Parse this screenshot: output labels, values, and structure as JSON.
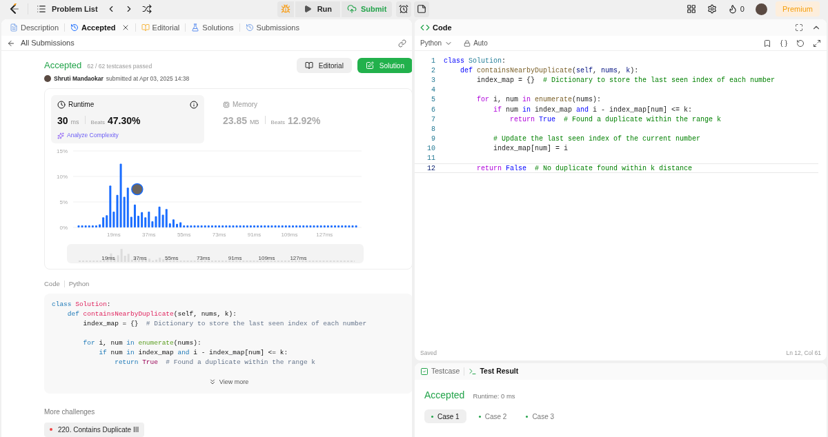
{
  "topbar": {
    "title": "Problem List",
    "run": "Run",
    "submit": "Submit",
    "streak": "0",
    "premium": "Premium"
  },
  "left_tabs": [
    {
      "label": "Description",
      "kind": "doc",
      "selected": false,
      "closable": false
    },
    {
      "label": "Accepted",
      "kind": "history",
      "selected": true,
      "closable": true
    },
    {
      "label": "Editorial",
      "kind": "book",
      "selected": false,
      "closable": false
    },
    {
      "label": "Solutions",
      "kind": "flask",
      "selected": false,
      "closable": false
    },
    {
      "label": "Submissions",
      "kind": "history",
      "selected": false,
      "closable": false
    }
  ],
  "back_link": "All Submissions",
  "submission": {
    "status": "Accepted",
    "testcases": "62 / 62 testcases passed",
    "author": "Shruti Mandaokar",
    "submitted": "submitted at Apr 03, 2025 14:38",
    "editorial_button": "Editorial",
    "solution_button": "Solution"
  },
  "stats": [
    {
      "label": "Runtime",
      "kind": "time",
      "value": "30",
      "unit": "ms",
      "beats_label": "Beats",
      "beats": "47.30%",
      "selected": true
    },
    {
      "label": "Memory",
      "kind": "memory",
      "value": "23.85",
      "unit": "MB",
      "beats_label": "Beats",
      "beats": "12.92%",
      "selected": false
    }
  ],
  "analyze": "Analyze Complexity",
  "chart": {
    "chart_data": {
      "type": "bar",
      "ylim": [
        0,
        15
      ],
      "xlim": [
        0,
        145
      ],
      "yticks": [
        {
          "value": 0,
          "label": "0%"
        },
        {
          "value": 5,
          "label": "5%"
        },
        {
          "value": 10,
          "label": "10%"
        },
        {
          "value": 15,
          "label": "15%"
        }
      ],
      "xticks": [
        {
          "value": 19,
          "label": "19ms"
        },
        {
          "value": 37,
          "label": "37ms"
        },
        {
          "value": 55,
          "label": "55ms"
        },
        {
          "value": 73,
          "label": "73ms"
        },
        {
          "value": 91,
          "label": "91ms"
        },
        {
          "value": 109,
          "label": "109ms"
        },
        {
          "value": 127,
          "label": "127ms"
        }
      ],
      "x": [
        1,
        2.8,
        4.6,
        6.4,
        8.2,
        10,
        11.8,
        13.6,
        15.4,
        17.2,
        19,
        20.8,
        22.6,
        24.4,
        26.2,
        28,
        29.8,
        31.6,
        33.4,
        35.2,
        37,
        38.8,
        40.6,
        42.4,
        44.2,
        46,
        47.8,
        49.6,
        51.4,
        53.2,
        55,
        56.8,
        58.6,
        60.4,
        62.2,
        64,
        65.8,
        67.6,
        69.4,
        71.2,
        73,
        74.8,
        76.6,
        78.4,
        80.2,
        82,
        83.8,
        85.6,
        87.4,
        89.2,
        91,
        92.8,
        94.6,
        96.4,
        98.2,
        100,
        101.8,
        103.6,
        105.4,
        107.2,
        109,
        110.8,
        112.6,
        114.4,
        116.2,
        118,
        119.8,
        121.6,
        123.4,
        125.2,
        127,
        128.8,
        130.6,
        132.4,
        134.2,
        136,
        137.8,
        139.6,
        141.4,
        143.2
      ],
      "series": [
        {
          "color": "#1a6dff",
          "values": [
            0.4,
            0.4,
            0.4,
            0.4,
            0.4,
            0.4,
            0.6,
            2.0,
            2.4,
            8.2,
            3.1,
            6.4,
            12.5,
            6.0,
            7.8,
            2.1,
            4.5,
            2.3,
            3.0,
            2.0,
            3.1,
            1.2,
            2.2,
            4.1,
            2.5,
            3.6,
            0.8,
            1.6,
            0.7,
            1.0,
            0.4,
            0.4,
            0.4,
            0.4,
            0.4,
            0.4,
            0.4,
            0.4,
            0.4,
            0.4,
            0.4,
            0.4,
            0.4,
            0.4,
            0.4,
            0.4,
            0.4,
            0.4,
            0.4,
            0.4,
            0.4,
            0.4,
            0.4,
            0.4,
            0.4,
            0.4,
            0.4,
            0.4,
            0.4,
            0.4,
            0.4,
            0.4,
            0.4,
            0.4,
            0.4,
            0.4,
            0.4,
            0.4,
            0.4,
            0.4,
            0.4,
            0.4,
            0.4,
            0.4,
            0.4,
            0.4,
            0.4,
            0.4,
            0.4,
            0.4
          ]
        }
      ]
    },
    "navigator_labels": [
      "19ms",
      "37ms",
      "55ms",
      "73ms",
      "91ms",
      "109ms",
      "127ms"
    ]
  },
  "code_section": {
    "label": "Code",
    "language": "Python",
    "view_more": "View more",
    "lines": [
      {
        "kind": "code",
        "tokens": [
          {
            "text": "class ",
            "kind": "kw"
          },
          {
            "text": "Solution",
            "kind": "type"
          },
          {
            "text": ":",
            "kind": "p"
          }
        ]
      },
      {
        "kind": "code",
        "tokens": [
          {
            "text": "    def ",
            "kind": "kw"
          },
          {
            "text": "containsNearbyDuplicate",
            "kind": "fn"
          },
          {
            "text": "(self, nums, k):",
            "kind": "p"
          }
        ]
      },
      {
        "kind": "code",
        "tokens": [
          {
            "text": "        index_map = {}  ",
            "kind": "p"
          },
          {
            "text": "# Dictionary to store the last seen index of each number",
            "kind": "cm"
          }
        ]
      },
      {
        "kind": "blank"
      },
      {
        "kind": "code",
        "tokens": [
          {
            "text": "        for ",
            "kind": "ctrl"
          },
          {
            "text": "i, num ",
            "kind": "p"
          },
          {
            "text": "in ",
            "kind": "kw"
          },
          {
            "text": "enumerate",
            "kind": "builtin"
          },
          {
            "text": "(nums):",
            "kind": "p"
          }
        ]
      },
      {
        "kind": "code",
        "tokens": [
          {
            "text": "            if ",
            "kind": "ctrl"
          },
          {
            "text": "num ",
            "kind": "p"
          },
          {
            "text": "in ",
            "kind": "kw"
          },
          {
            "text": "index_map ",
            "kind": "p"
          },
          {
            "text": "and ",
            "kind": "kw"
          },
          {
            "text": "i - index_map[num] <= k:",
            "kind": "p"
          }
        ]
      },
      {
        "kind": "code",
        "tokens": [
          {
            "text": "                return ",
            "kind": "ctrl"
          },
          {
            "text": "True  ",
            "kind": "const"
          },
          {
            "text": "# Found a duplicate within the range k",
            "kind": "cm"
          }
        ]
      }
    ]
  },
  "more_challenges": {
    "title": "More challenges",
    "items": [
      {
        "label": "220. Contains Duplicate III",
        "color": "#ef4444"
      }
    ]
  },
  "editor": {
    "title": "Code",
    "language": "Python",
    "mode": "Auto",
    "status": "Saved",
    "cursor": "Ln 12, Col 61",
    "lines": [
      {
        "no": "1",
        "active": false,
        "tokens": [
          {
            "text": "class ",
            "kind": "kw"
          },
          {
            "text": "Solution",
            "kind": "type"
          },
          {
            "text": ":",
            "kind": "p"
          }
        ]
      },
      {
        "no": "2",
        "active": false,
        "tokens": [
          {
            "text": "    def ",
            "kind": "kw"
          },
          {
            "text": "containsNearbyDuplicate",
            "kind": "fn"
          },
          {
            "text": "(",
            "kind": "p"
          },
          {
            "text": "self",
            "kind": "param"
          },
          {
            "text": ", ",
            "kind": "p"
          },
          {
            "text": "nums",
            "kind": "param"
          },
          {
            "text": ", ",
            "kind": "p"
          },
          {
            "text": "k",
            "kind": "param"
          },
          {
            "text": "):",
            "kind": "p"
          }
        ]
      },
      {
        "no": "3",
        "active": false,
        "tokens": [
          {
            "text": "        index_map = {}  ",
            "kind": "p"
          },
          {
            "text": "# Dictionary to store the last seen index of each number",
            "kind": "cm"
          }
        ]
      },
      {
        "no": "4",
        "active": false
      },
      {
        "no": "5",
        "active": false,
        "tokens": [
          {
            "text": "        for ",
            "kind": "ctrl"
          },
          {
            "text": "i, num ",
            "kind": "p"
          },
          {
            "text": "in ",
            "kind": "ctrl"
          },
          {
            "text": "enumerate",
            "kind": "builtin"
          },
          {
            "text": "(nums):",
            "kind": "p"
          }
        ]
      },
      {
        "no": "6",
        "active": false,
        "tokens": [
          {
            "text": "            if ",
            "kind": "ctrl"
          },
          {
            "text": "num ",
            "kind": "p"
          },
          {
            "text": "in ",
            "kind": "kw"
          },
          {
            "text": "index_map ",
            "kind": "p"
          },
          {
            "text": "and ",
            "kind": "kw"
          },
          {
            "text": "i - index_map[num] <= k:",
            "kind": "p"
          }
        ]
      },
      {
        "no": "7",
        "active": false,
        "tokens": [
          {
            "text": "                return ",
            "kind": "ctrl"
          },
          {
            "text": "True  ",
            "kind": "const"
          },
          {
            "text": "# Found a duplicate within the range k",
            "kind": "cm"
          }
        ]
      },
      {
        "no": "8",
        "active": false
      },
      {
        "no": "9",
        "active": false,
        "tokens": [
          {
            "text": "            # Update the last seen index of the current number",
            "kind": "cm"
          }
        ]
      },
      {
        "no": "10",
        "active": false,
        "tokens": [
          {
            "text": "            index_map[num] = i",
            "kind": "p"
          }
        ]
      },
      {
        "no": "11",
        "active": false
      },
      {
        "no": "12",
        "active": true,
        "tokens": [
          {
            "text": "        return ",
            "kind": "ctrl"
          },
          {
            "text": "False  ",
            "kind": "const"
          },
          {
            "text": "# No duplicate found within k distance",
            "kind": "cm"
          }
        ]
      }
    ]
  },
  "test_panel": {
    "tabs": [
      {
        "label": "Testcase",
        "kind": "check",
        "selected": false
      },
      {
        "label": "Test Result",
        "kind": "terminal",
        "selected": true
      }
    ],
    "status": "Accepted",
    "runtime": "Runtime: 0 ms",
    "cases": [
      {
        "label": "Case 1",
        "selected": true
      },
      {
        "label": "Case 2",
        "selected": false
      },
      {
        "label": "Case 3",
        "selected": false
      }
    ]
  }
}
